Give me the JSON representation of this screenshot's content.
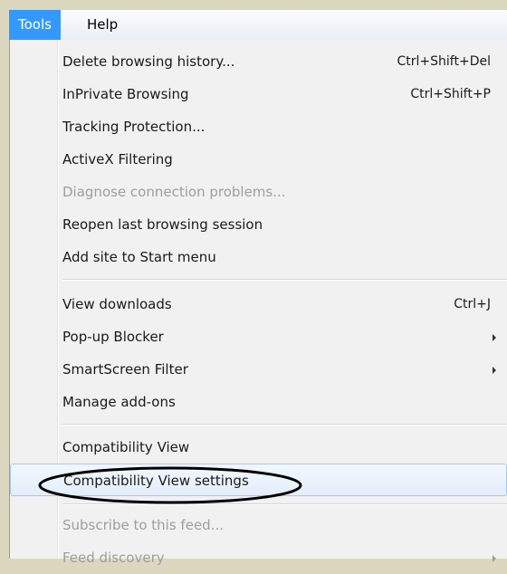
{
  "menubar": {
    "tools": "Tools",
    "help": "Help"
  },
  "menu": {
    "items": [
      {
        "label": "Delete browsing history...",
        "shortcut": "Ctrl+Shift+Del"
      },
      {
        "label": "InPrivate Browsing",
        "shortcut": "Ctrl+Shift+P"
      },
      {
        "label": "Tracking Protection..."
      },
      {
        "label": "ActiveX Filtering"
      },
      {
        "label": "Diagnose connection problems..."
      },
      {
        "label": "Reopen last browsing session"
      },
      {
        "label": "Add site to Start menu"
      },
      {
        "label": "View downloads",
        "shortcut": "Ctrl+J"
      },
      {
        "label": "Pop-up Blocker"
      },
      {
        "label": "SmartScreen Filter"
      },
      {
        "label": "Manage add-ons"
      },
      {
        "label": "Compatibility View"
      },
      {
        "label": "Compatibility View settings"
      },
      {
        "label": "Subscribe to this feed..."
      },
      {
        "label": "Feed discovery"
      }
    ]
  },
  "colors": {
    "menubar_active": "#3399ff",
    "highlight_border": "#a8c8ee",
    "disabled_text": "#9e9e9e"
  }
}
